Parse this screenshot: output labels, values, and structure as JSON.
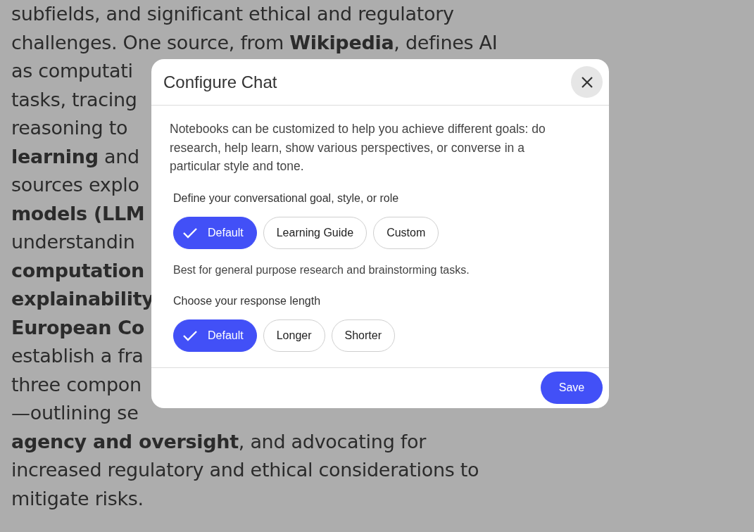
{
  "article_lines": [
    {
      "text": "subfields, and significant ethical and regulatory",
      "bold": false
    },
    {
      "text": "challenges. One source, from **Wikipedia**, defines AI",
      "bold": false
    },
    {
      "text": "as computati",
      "bold": false
    },
    {
      "text": "tasks, tracing",
      "bold": false
    },
    {
      "text": "reasoning to",
      "bold": false
    },
    {
      "text": "**learning** and",
      "bold": false
    },
    {
      "text": "sources explo",
      "bold": false
    },
    {
      "text": "models (LLM",
      "bold": true
    },
    {
      "text": "understandin",
      "bold": false
    },
    {
      "text": "computation",
      "bold": true
    },
    {
      "text": "explainability",
      "bold": true
    },
    {
      "text": "European Co",
      "bold": true
    },
    {
      "text": "establish a fra",
      "bold": false
    },
    {
      "text": "three compon",
      "bold": false
    },
    {
      "text": "—outlining se",
      "bold": false
    },
    {
      "text": "**agency and oversight**, and advocating for",
      "bold": false
    },
    {
      "text": "increased regulatory and ethical considerations to",
      "bold": false
    },
    {
      "text": "mitigate risks.",
      "bold": false
    }
  ],
  "dialog": {
    "title": "Configure Chat",
    "intro": "Notebooks can be customized to help you achieve different goals: do research, help learn, show various perspectives, or converse in a particular style and tone.",
    "sections": [
      {
        "label": "Define your conversational goal, style, or role",
        "options": [
          {
            "label": "Default",
            "selected": true
          },
          {
            "label": "Learning Guide",
            "selected": false
          },
          {
            "label": "Custom",
            "selected": false
          }
        ],
        "hint": "Best for general purpose research and brainstorming tasks."
      },
      {
        "label": "Choose your response length",
        "options": [
          {
            "label": "Default",
            "selected": true
          },
          {
            "label": "Longer",
            "selected": false
          },
          {
            "label": "Shorter",
            "selected": false
          }
        ]
      }
    ],
    "save": "Save"
  }
}
